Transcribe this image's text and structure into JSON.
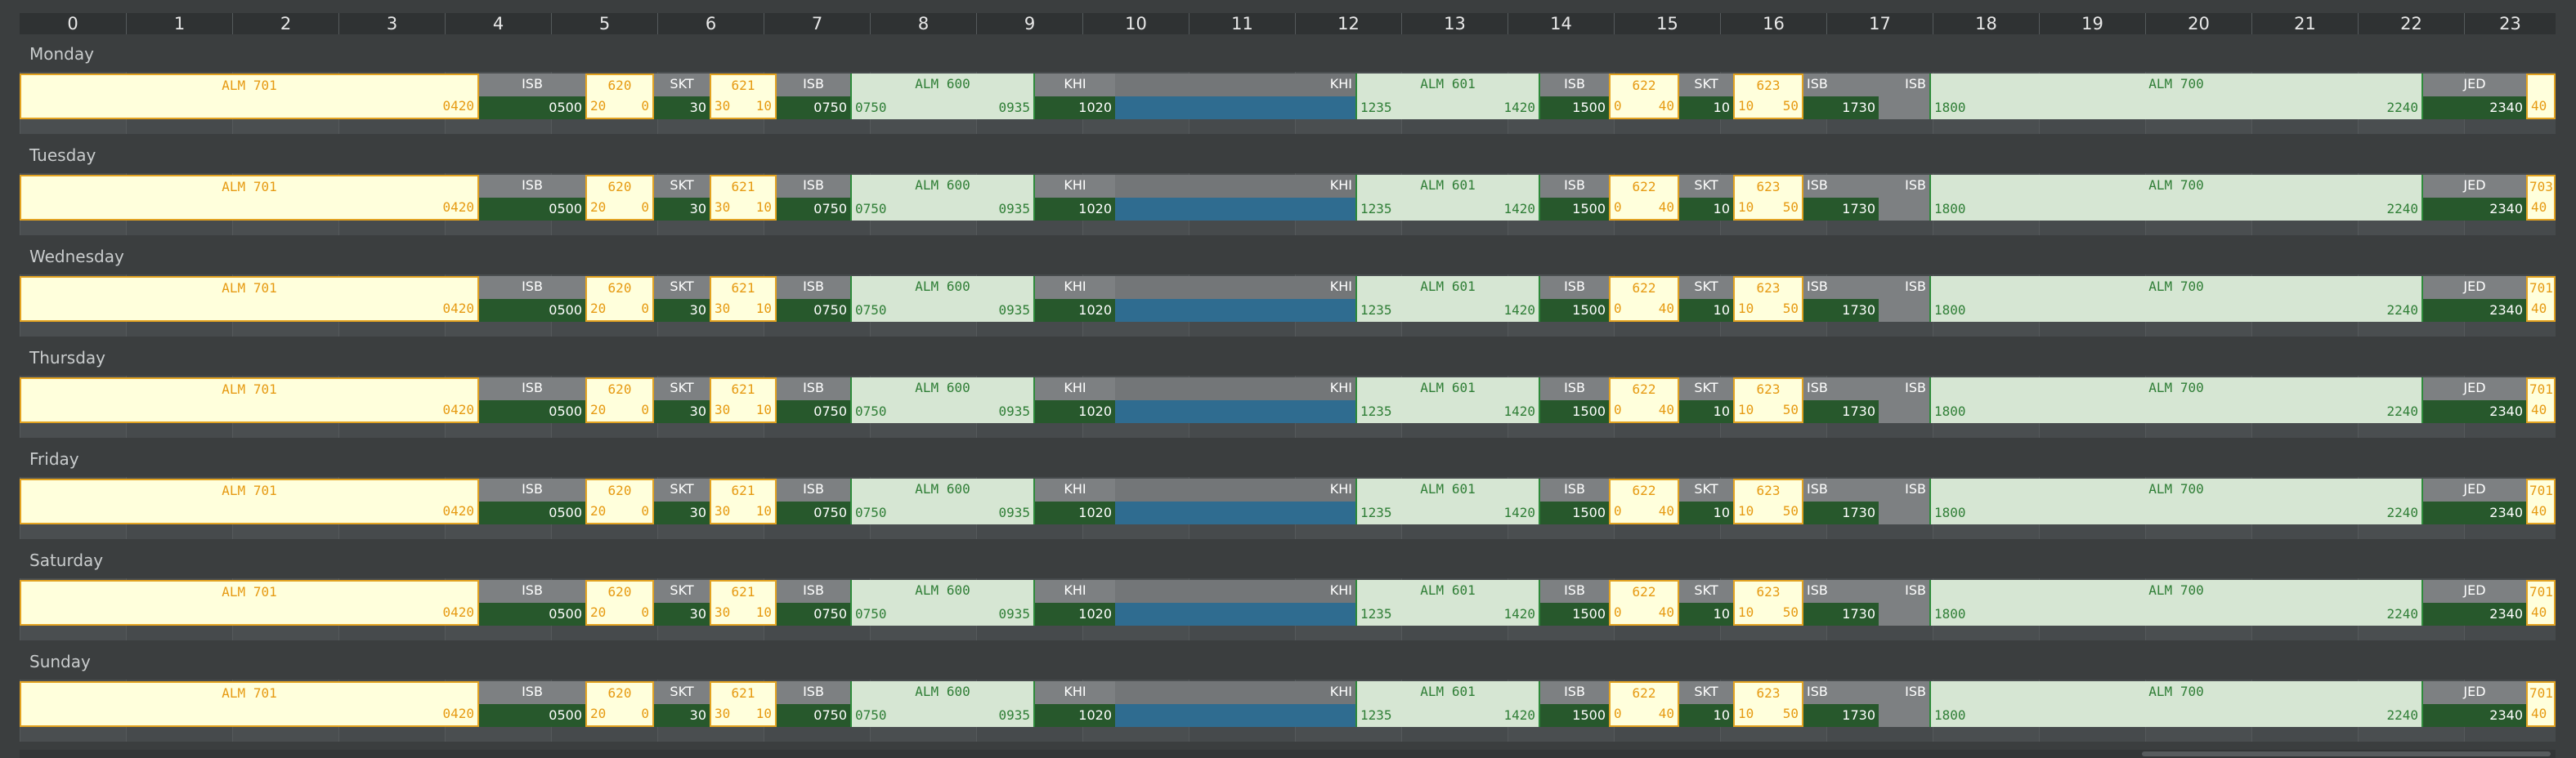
{
  "hours": [
    "0",
    "1",
    "2",
    "3",
    "4",
    "5",
    "6",
    "7",
    "8",
    "9",
    "10",
    "11",
    "12",
    "13",
    "14",
    "15",
    "16",
    "17",
    "18",
    "19",
    "20",
    "21",
    "22",
    "23"
  ],
  "days": [
    "Monday",
    "Tuesday",
    "Wednesday",
    "Thursday",
    "Friday",
    "Saturday",
    "Sunday"
  ],
  "blocks": [
    {
      "kind": "yellow",
      "title": "ALM 701",
      "start": "",
      "end": "0420"
    },
    {
      "kind": "gray",
      "title": "ISB",
      "end": "0500"
    },
    {
      "kind": "yellow",
      "title": "620",
      "start": "20",
      "end": "0"
    },
    {
      "kind": "gray",
      "title": "SKT",
      "end": "30"
    },
    {
      "kind": "yellow",
      "title": "621",
      "start": "30",
      "end": "10"
    },
    {
      "kind": "gray",
      "title": "ISB",
      "end": "0750"
    },
    {
      "kind": "light",
      "title": "ALM 600",
      "start": "0750",
      "end": "0935"
    },
    {
      "kind": "gray",
      "title": "KHI",
      "end": "1020"
    },
    {
      "kind": "transit",
      "title": "KHI"
    },
    {
      "kind": "light",
      "title": "ALM 601",
      "start": "1235",
      "end": "1420"
    },
    {
      "kind": "gray",
      "title": "ISB",
      "end": "1500"
    },
    {
      "kind": "yellow",
      "title": "622",
      "start": "0",
      "end": "40"
    },
    {
      "kind": "gray",
      "title": "SKT",
      "end": "10"
    },
    {
      "kind": "yellow",
      "title": "623",
      "start": "10",
      "end": "50"
    },
    {
      "kind": "gray-two",
      "title_left": "ISB",
      "title_right": "ISB",
      "end": "1730"
    },
    {
      "kind": "light",
      "title": "ALM 700",
      "start": "1800",
      "end": "2240"
    },
    {
      "kind": "gray",
      "title": "JED",
      "end": "2340"
    },
    {
      "kind": "yellow",
      "title": "",
      "start": "40",
      "end": ""
    }
  ],
  "tail_labels": [
    "",
    "703",
    "701",
    "701",
    "701",
    "701",
    "701"
  ],
  "colors": {
    "background": "#3b3e3f",
    "yellow_fill": "#ffffdc",
    "yellow_border": "#e3a321",
    "yellow_text": "#e69a12",
    "flight_fill": "#d6e6d3",
    "flight_text": "#2f7e36",
    "station_fill": "#7d8082",
    "station_dark": "#27582c",
    "transit_blue": "#2f6c90"
  }
}
